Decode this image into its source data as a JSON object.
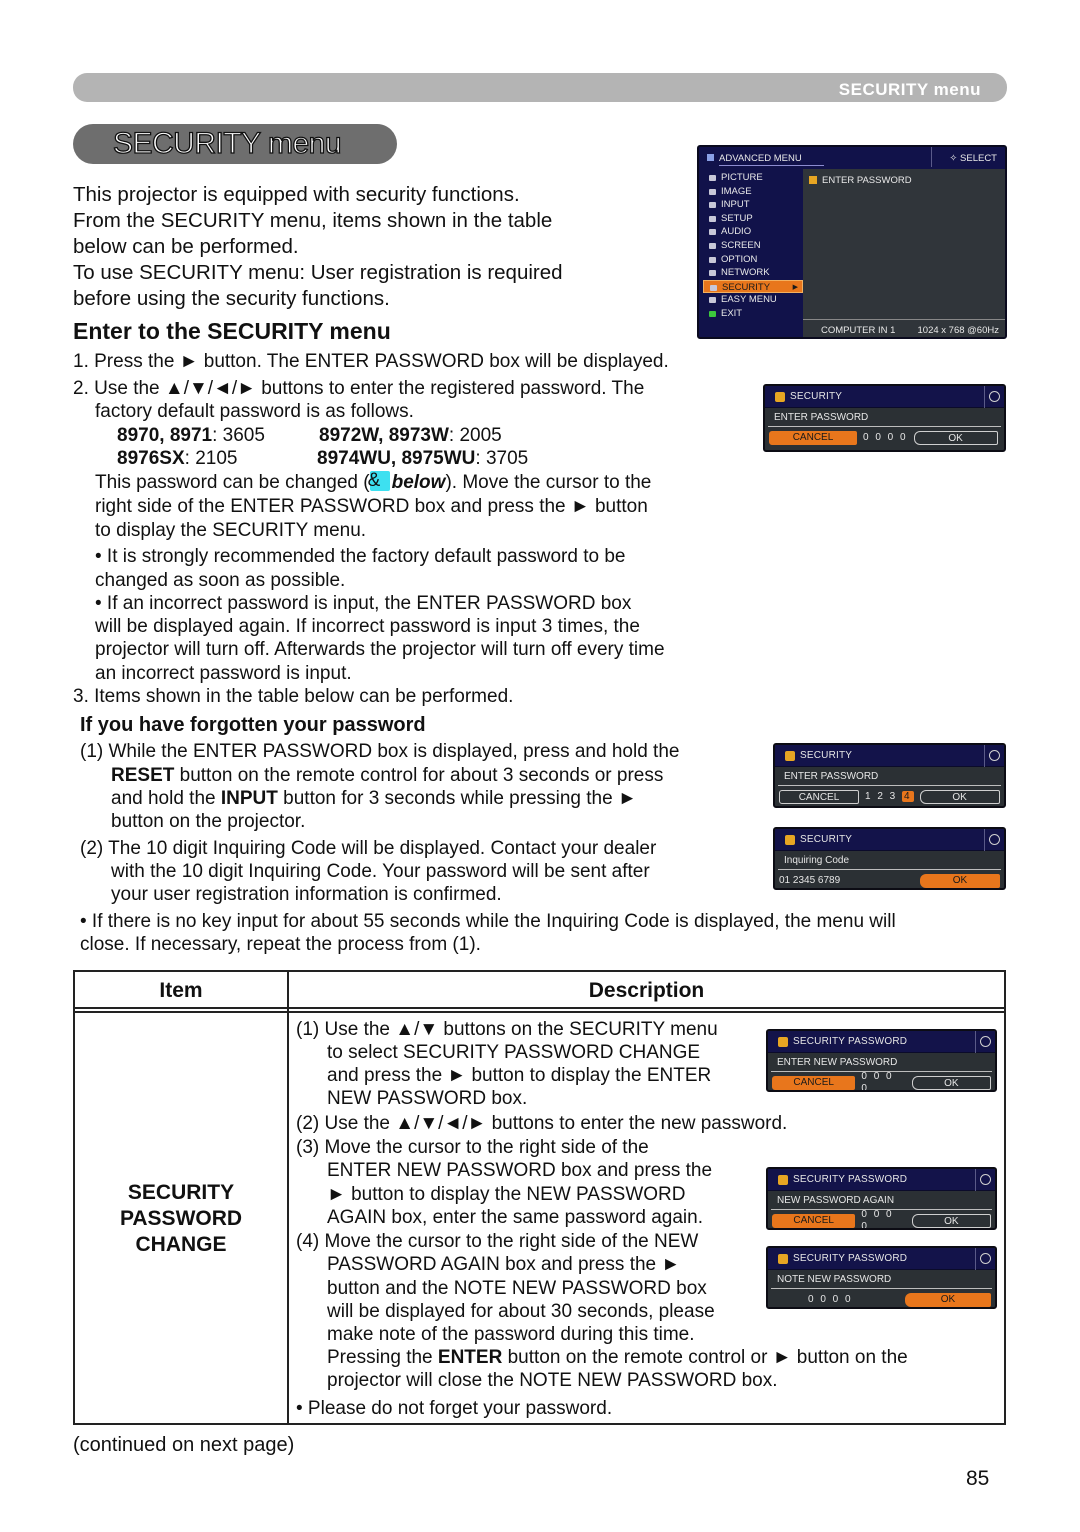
{
  "header": {
    "section_label": "SECURITY menu",
    "page_title": "SECURITY menu"
  },
  "intro": [
    "This projector is equipped with security functions.",
    "From the SECURITY menu, items shown in the table",
    "below can be performed.",
    "To use SECURITY menu: User registration is required",
    "before using the security functions."
  ],
  "enter_section": {
    "heading": "Enter to the SECURITY menu",
    "step1": "1. Press the ► button. The ENTER PASSWORD box will be displayed.",
    "step2_line1": "2. Use the ▲/▼/◄/► buttons to enter the registered password. The",
    "step2_line2": "factory default password is as follows.",
    "defaults": [
      {
        "models": "8970, 8971",
        "password": "3605"
      },
      {
        "models": "8972W, 8973W",
        "password": "2005"
      },
      {
        "models": "8976SX",
        "password": "2105"
      },
      {
        "models": "8974WU, 8975WU",
        "password": "3705"
      }
    ],
    "change_line1_a": "This password can be changed (",
    "change_line1_ref": "below",
    "change_line1_b": "). Move the cursor to the",
    "change_line2": "right side of the ENTER PASSWORD box and press the ► button",
    "change_line3": "to display the SECURITY menu.",
    "note1_line1": "• It is strongly recommended the factory default password to be",
    "note1_line2": "changed as soon as possible.",
    "note2_line1": "• If an incorrect password is input, the ENTER PASSWORD box",
    "note2_line2": "will be displayed again. If incorrect password is input 3 times, the",
    "note2_line3": "projector will turn off. Afterwards the projector will turn off every time",
    "note2_line4": "an incorrect password is input.",
    "step3": "3. Items shown in the table below can be performed."
  },
  "forgot_section": {
    "heading": "If you have forgotten your password",
    "p1_line1": "(1) While the ENTER PASSWORD box is displayed, press and hold the",
    "p1_line2_bold": "RESET",
    "p1_line2_rest": " button on the remote control for about 3 seconds or press",
    "p1_line3_a": "and hold the ",
    "p1_line3_bold": "INPUT",
    "p1_line3_b": " button for 3 seconds while pressing the ►",
    "p1_line4": "button on the projector.",
    "p2_line1": "(2) The 10 digit Inquiring Code will be displayed. Contact your dealer",
    "p2_line2": "with the 10 digit Inquiring Code. Your password will be sent after",
    "p2_line3": "your user registration information is confirmed.",
    "note_line1": "• If there is no key input for about 55 seconds while the Inquiring Code is displayed, the menu will",
    "note_line2": "close. If necessary, repeat the process from (1)."
  },
  "osd": {
    "advanced_menu": {
      "title": "ADVANCED MENU",
      "select_hint": "SELECT",
      "items": [
        "PICTURE",
        "IMAGE",
        "INPUT",
        "SETUP",
        "AUDIO",
        "SCREEN",
        "OPTION",
        "NETWORK",
        "SECURITY",
        "EASY MENU",
        "EXIT"
      ],
      "active_item": "SECURITY",
      "pane_item": "ENTER PASSWORD",
      "source": "COMPUTER IN 1",
      "resolution": "1024 x 768 @60Hz"
    },
    "enter_password": {
      "title": "SECURITY",
      "label": "ENTER PASSWORD",
      "cancel": "CANCEL",
      "digits": "0 0 0 0",
      "ok": "OK"
    },
    "enter_password_filled": {
      "title": "SECURITY",
      "label": "ENTER PASSWORD",
      "cancel": "CANCEL",
      "digits": "1 2 3",
      "selected_digit": "4",
      "ok": "OK"
    },
    "inquiring_code": {
      "title": "SECURITY",
      "label": "Inquiring Code",
      "code": "01 2345 6789",
      "ok": "OK"
    },
    "enter_new_password": {
      "title": "SECURITY PASSWORD",
      "label": "ENTER NEW PASSWORD",
      "cancel": "CANCEL",
      "digits": "0 0 0 0",
      "ok": "OK"
    },
    "new_password_again": {
      "title": "SECURITY PASSWORD",
      "label": "NEW PASSWORD AGAIN",
      "cancel": "CANCEL",
      "digits": "0 0 0 0",
      "ok": "OK"
    },
    "note_new_password": {
      "title": "SECURITY PASSWORD",
      "label": "NOTE NEW PASSWORD",
      "digits": "0 0 0 0",
      "ok": "OK"
    }
  },
  "table": {
    "headers": [
      "Item",
      "Description"
    ],
    "row": {
      "item_lines": [
        "SECURITY",
        "PASSWORD",
        "CHANGE"
      ],
      "desc": [
        "(1) Use the ▲/▼ buttons on the SECURITY menu",
        "to select SECURITY PASSWORD CHANGE",
        "and press the ► button to display the ENTER",
        "NEW PASSWORD box.",
        "(2) Use the ▲/▼/◄/► buttons to enter the new password.",
        "(3) Move the cursor to the right side of the",
        "ENTER NEW PASSWORD box and press the",
        "► button to display the NEW PASSWORD",
        "AGAIN box, enter the same password again.",
        "(4) Move the cursor to the right side of the NEW",
        "PASSWORD AGAIN box and press the ►",
        "button and the NOTE NEW PASSWORD box",
        "will be displayed for about 30 seconds, please",
        "make note of the password during this time."
      ],
      "enter_a": "Pressing the ",
      "enter_bold": "ENTER",
      "enter_b": " button on the remote control or ► button on the",
      "enter_line2": "projector will close the NOTE NEW PASSWORD box.",
      "bullet": "• Please do not forget your password."
    }
  },
  "footer": {
    "continued": "(continued on next page)",
    "page_number": "85"
  }
}
